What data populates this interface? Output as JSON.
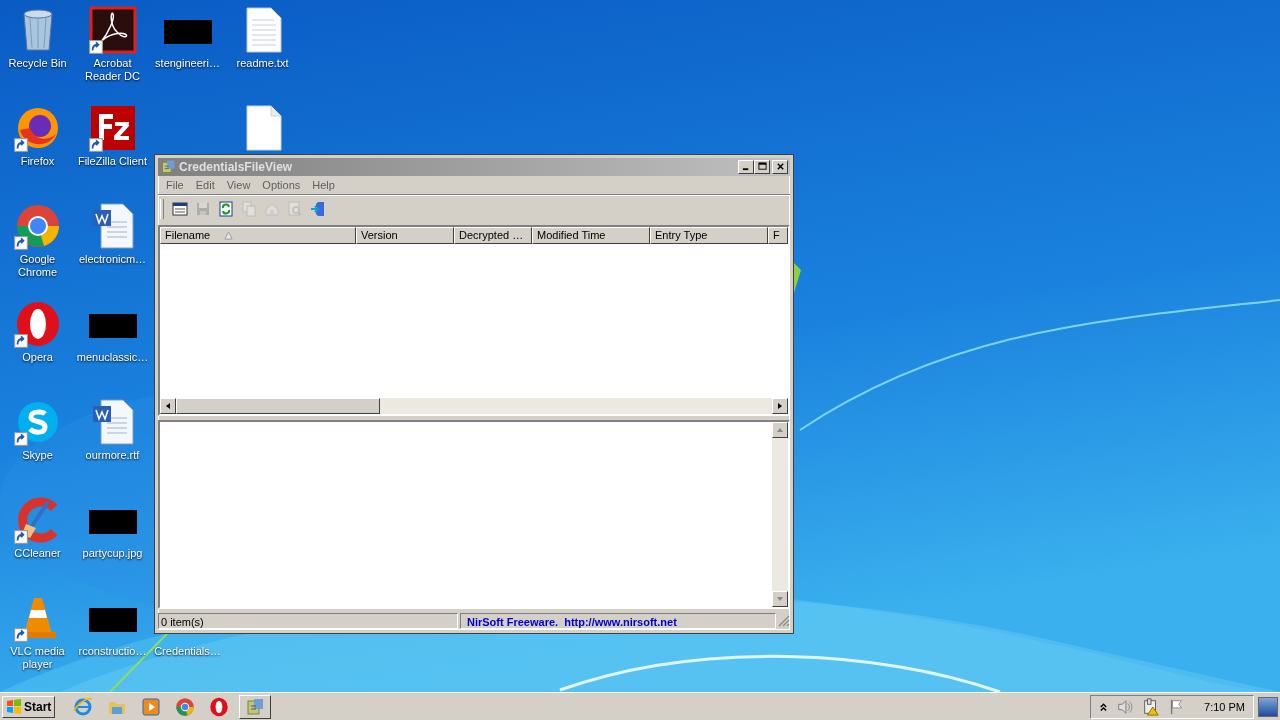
{
  "desktop": {
    "columns": [
      [
        {
          "kind": "recycle-bin",
          "label": "Recycle Bin",
          "shortcut": false
        },
        {
          "kind": "firefox",
          "label": "Firefox",
          "shortcut": true
        },
        {
          "kind": "chrome",
          "label": "Google Chrome",
          "shortcut": true
        },
        {
          "kind": "opera",
          "label": "Opera",
          "shortcut": true
        },
        {
          "kind": "skype",
          "label": "Skype",
          "shortcut": true
        },
        {
          "kind": "ccleaner",
          "label": "CCleaner",
          "shortcut": true
        },
        {
          "kind": "vlc",
          "label": "VLC media player",
          "shortcut": true
        }
      ],
      [
        {
          "kind": "acrobat",
          "label": "Acrobat Reader DC",
          "shortcut": true
        },
        {
          "kind": "filezilla",
          "label": "FileZilla Client",
          "shortcut": true
        },
        {
          "kind": "word",
          "label": "electronicm…",
          "shortcut": false
        },
        {
          "kind": "redacted",
          "label": "menuclassic…",
          "shortcut": false
        },
        {
          "kind": "word",
          "label": "ourmore.rtf",
          "shortcut": false
        },
        {
          "kind": "redacted",
          "label": "partycup.jpg",
          "shortcut": false
        },
        {
          "kind": "redacted",
          "label": "rconstructio…",
          "shortcut": false
        }
      ],
      [
        {
          "kind": "redacted",
          "label": "stengineeri…",
          "shortcut": false
        },
        {
          "kind": "covered",
          "label": "Credentials…"
        }
      ],
      [
        {
          "kind": "text-file",
          "label": "readme.txt",
          "shortcut": false
        },
        {
          "kind": "blank-file",
          "shortcut": false
        }
      ]
    ]
  },
  "window": {
    "title": "CredentialsFileView",
    "active": false,
    "menu": [
      "File",
      "Edit",
      "View",
      "Options",
      "Help"
    ],
    "toolbar": [
      {
        "kind": "properties",
        "disabled": false
      },
      {
        "kind": "save",
        "disabled": true
      },
      {
        "kind": "refresh",
        "disabled": false
      },
      {
        "kind": "copy",
        "disabled": true
      },
      {
        "kind": "html",
        "disabled": true
      },
      {
        "kind": "find",
        "disabled": true
      },
      {
        "kind": "exit",
        "disabled": false
      }
    ],
    "columns": [
      {
        "label": "Filename",
        "sorted": true
      },
      {
        "label": "Version",
        "sorted": false
      },
      {
        "label": "Decrypted …",
        "sorted": false
      },
      {
        "label": "Modified Time",
        "sorted": false
      },
      {
        "label": "Entry Type",
        "sorted": false
      },
      {
        "label": "F",
        "sorted": false
      }
    ],
    "status": [
      "0 item(s)",
      "NirSoft Freeware.  http://www.nirsoft.net"
    ]
  },
  "taskbar": {
    "start": "Start",
    "quick_launch": [
      {
        "kind": "ie"
      },
      {
        "kind": "explorer"
      },
      {
        "kind": "media-player"
      },
      {
        "kind": "chrome"
      },
      {
        "kind": "opera"
      }
    ],
    "tasks": [
      {
        "kind": "app",
        "selected": false
      }
    ],
    "tray": {
      "icons": [
        {
          "kind": "chevron"
        },
        {
          "kind": "speaker"
        },
        {
          "kind": "network-warning"
        },
        {
          "kind": "flag"
        }
      ],
      "clock": "7:10 PM"
    }
  }
}
